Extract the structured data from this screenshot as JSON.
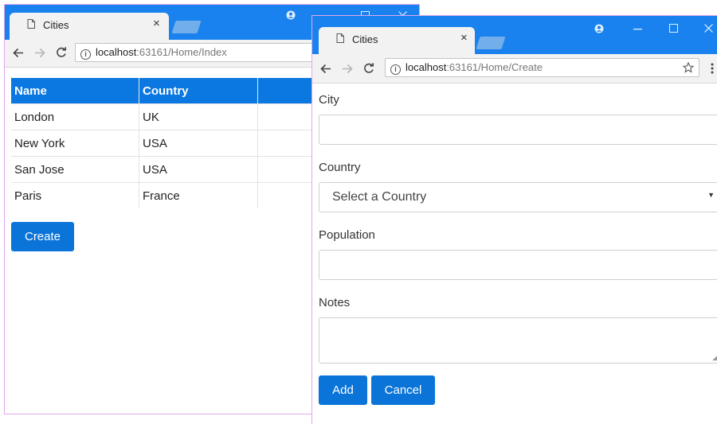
{
  "index_window": {
    "tab_title": "Cities",
    "tab_close": "×",
    "url_host": "localhost",
    "url_path": ":63161/Home/Index",
    "table": {
      "headers": [
        "Name",
        "Country"
      ],
      "rows": [
        [
          "London",
          "UK"
        ],
        [
          "New York",
          "USA"
        ],
        [
          "San Jose",
          "USA"
        ],
        [
          "Paris",
          "France"
        ]
      ]
    },
    "create_button": "Create"
  },
  "create_window": {
    "tab_title": "Cities",
    "tab_close": "×",
    "url_host": "localhost",
    "url_path": ":63161/Home/Create",
    "form": {
      "city_label": "City",
      "city_value": "",
      "country_label": "Country",
      "country_selected": "Select a Country",
      "population_label": "Population",
      "population_value": "",
      "notes_label": "Notes",
      "notes_value": ""
    },
    "add_button": "Add",
    "cancel_button": "Cancel"
  },
  "icons": {
    "back": "back-arrow-icon",
    "forward": "forward-arrow-icon",
    "reload": "reload-icon",
    "info": "info-icon",
    "star": "bookmark-star-icon",
    "menu": "menu-dots-icon",
    "profile": "profile-icon",
    "minimize": "minimize-icon",
    "maximize": "maximize-icon",
    "close": "close-icon",
    "page": "page-icon"
  },
  "colors": {
    "titlebar": "#1a82ee",
    "accent": "#0a74d8",
    "table_header": "#0a78e0"
  }
}
